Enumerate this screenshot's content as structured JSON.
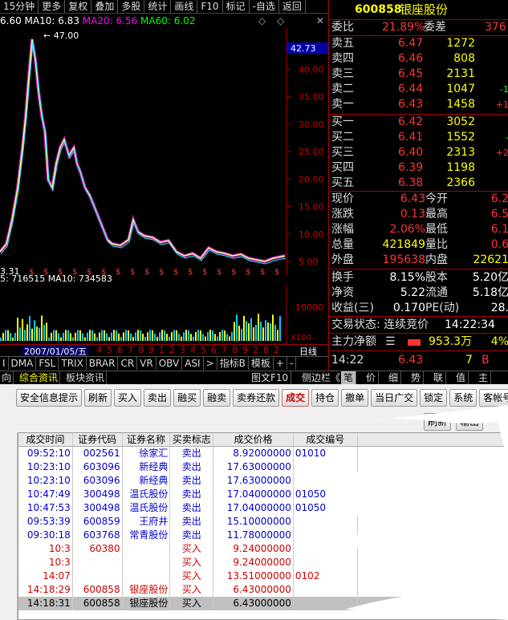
{
  "toolbar": {
    "items": [
      "15分钟",
      "更多",
      "复权",
      "叠加",
      "多股",
      "统计",
      "画线",
      "F10",
      "标记",
      "-自选",
      "返回"
    ]
  },
  "ma_legend": {
    "prefix": "6.60",
    "ma10": "MA10: 6.83",
    "ma20": "MA20: 6.56",
    "ma60": "MA60: 6.02"
  },
  "price_chart": {
    "high_label": "47.00",
    "low_label": "3.31",
    "current_price_tag": "42.73",
    "ylabels": [
      "40.00",
      "35.00",
      "30.00",
      "25.00",
      "20.00",
      "15.00",
      "10.00",
      "5.00"
    ]
  },
  "volume": {
    "legend": "5: 716515  MA10: 734583",
    "ylabel": "10000",
    "unit_label": "X100"
  },
  "datebar": {
    "date": "2007/01/05/五",
    "ticks": [
      "8",
      "9",
      "1",
      "2",
      "3",
      "4",
      "5",
      "6",
      "7",
      "8",
      "9",
      "1",
      "2",
      "3",
      "4",
      "5",
      "6",
      "7",
      "8",
      "9",
      "2",
      "8",
      "2"
    ],
    "right_label": "日线"
  },
  "indicators": {
    "items": [
      "I",
      "DMA",
      "FSL",
      "TRIX",
      "BRAR",
      "CR",
      "VR",
      "OBV",
      "ASI",
      ">",
      "指标B",
      "模板",
      "+",
      "-"
    ]
  },
  "tabbar": {
    "left": [
      "向",
      "综合资讯",
      "板块资讯"
    ],
    "right": [
      "图文F10",
      "侧边栏《",
      "笔",
      "价",
      "细",
      "势",
      "联",
      "值",
      "主"
    ]
  },
  "quote": {
    "code": "600858",
    "name": "银座股份",
    "weibi_label": "委比",
    "weibi": "21.89%",
    "weicha_label": "委差",
    "weicha": "376",
    "asks": [
      {
        "label": "卖五",
        "price": "6.47",
        "vol": "1272",
        "chg": ""
      },
      {
        "label": "卖四",
        "price": "6.46",
        "vol": "808",
        "chg": ""
      },
      {
        "label": "卖三",
        "price": "6.45",
        "vol": "2131",
        "chg": ""
      },
      {
        "label": "卖二",
        "price": "6.44",
        "vol": "1047",
        "chg": "-1"
      },
      {
        "label": "卖一",
        "price": "6.43",
        "vol": "1458",
        "chg": "+1"
      }
    ],
    "bids": [
      {
        "label": "买一",
        "price": "6.42",
        "vol": "3052",
        "chg": ""
      },
      {
        "label": "买二",
        "price": "6.41",
        "vol": "1552",
        "chg": "-"
      },
      {
        "label": "买三",
        "price": "6.40",
        "vol": "2313",
        "chg": "+2"
      },
      {
        "label": "买四",
        "price": "6.39",
        "vol": "1198",
        "chg": ""
      },
      {
        "label": "买五",
        "price": "6.38",
        "vol": "2366",
        "chg": ""
      }
    ],
    "stats": [
      {
        "l1": "现价",
        "v1": "6.43",
        "l2": "今开",
        "v2": "6.2"
      },
      {
        "l1": "涨跌",
        "v1": "0.13",
        "l2": "最高",
        "v2": "6.5"
      },
      {
        "l1": "涨幅",
        "v1": "2.06%",
        "l2": "最低",
        "v2": "6.1"
      },
      {
        "l1": "总量",
        "v1": "421849",
        "l2": "量比",
        "v2": "0.6"
      },
      {
        "l1": "外盘",
        "v1": "195638",
        "l2": "内盘",
        "v2": "22621"
      }
    ],
    "stats2": [
      {
        "l1": "换手",
        "v1": "8.15%",
        "l2": "股本",
        "v2": "5.20亿"
      },
      {
        "l1": "净资",
        "v1": "5.22",
        "l2": "流通",
        "v2": "5.18亿"
      },
      {
        "l1": "收益(三)",
        "v1": "0.170",
        "l2": "PE(动)",
        "v2": "28."
      }
    ],
    "trade_status": "交易状态: 连续竞价",
    "trade_time": "14:22:34",
    "main_net_label": "主力净额",
    "main_net": "953.3万",
    "main_net_pct": "4%",
    "tick": {
      "time": "14:22",
      "price": "6.43",
      "vol": "7",
      "side": "B"
    }
  },
  "buttons": [
    "安全信息提示",
    "刷新",
    "买入",
    "卖出",
    "融买",
    "融卖",
    "卖券还款",
    "成交",
    "持仓",
    "撤单",
    "当日广交",
    "锁定",
    "系统",
    "客帐号"
  ],
  "subbuttons": [
    "刷新",
    "输出"
  ],
  "table": {
    "headers": [
      "成交时间",
      "证券代码",
      "证券名称",
      "买卖标志",
      "成交价格",
      "成交编号",
      ""
    ],
    "rows": [
      {
        "time": "09:52:10",
        "code": "002561",
        "name": "徐家汇",
        "side": "卖出",
        "price": "8.92000000",
        "no": "01010"
      },
      {
        "time": "10:23:10",
        "code": "603096",
        "name": "新经典",
        "side": "卖出",
        "price": "17.63000000",
        "no": ""
      },
      {
        "time": "10:23:10",
        "code": "603096",
        "name": "新经典",
        "side": "卖出",
        "price": "17.63000000",
        "no": ""
      },
      {
        "time": "10:47:49",
        "code": "300498",
        "name": "温氏股份",
        "side": "卖出",
        "price": "17.04000000",
        "no": "01050"
      },
      {
        "time": "10:47:53",
        "code": "300498",
        "name": "温氏股份",
        "side": "卖出",
        "price": "17.04000000",
        "no": "01050"
      },
      {
        "time": "09:53:39",
        "code": "600859",
        "name": "王府井",
        "side": "卖出",
        "price": "15.10000000",
        "no": ""
      },
      {
        "time": "09:30:18",
        "code": "603768",
        "name": "常青股份",
        "side": "卖出",
        "price": "11.78000000",
        "no": ""
      },
      {
        "time": "10:3",
        "code": "60380",
        "name": "",
        "side": "买入",
        "price": "9.24000000",
        "no": ""
      },
      {
        "time": "10:3",
        "code": "",
        "name": "",
        "side": "买入",
        "price": "9.24000000",
        "no": ""
      },
      {
        "time": "14:07",
        "code": "",
        "name": "",
        "side": "买入",
        "price": "13.51000000",
        "no": "0102"
      },
      {
        "time": "14:18:29",
        "code": "600858",
        "name": "银座股份",
        "side": "买入",
        "price": "6.43000000",
        "no": ""
      },
      {
        "time": "14:18:31",
        "code": "600858",
        "name": "银座股份",
        "side": "买入",
        "price": "6.43000000",
        "no": ""
      }
    ]
  },
  "colors": {
    "red": "#ff3333",
    "green": "#22ff22",
    "yellow": "#ffff00",
    "blue": "#0000cc",
    "frame": "#aa0000"
  }
}
